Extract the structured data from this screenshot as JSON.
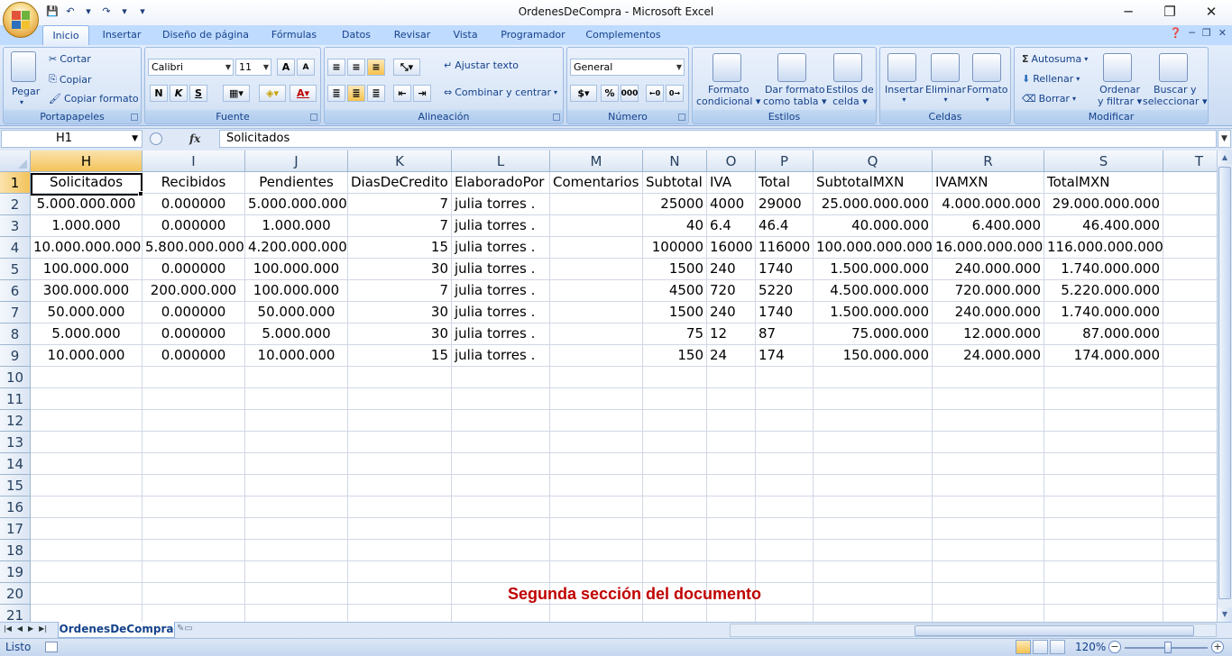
{
  "window": {
    "title": "OrdenesDeCompra - Microsoft Excel",
    "minimize": "─",
    "restore": "❐",
    "close": "✕"
  },
  "qat": {
    "save": "💾",
    "undo": "↶",
    "redo": "↷",
    "customize": "▾"
  },
  "tabs": [
    {
      "label": "Inicio",
      "active": true
    },
    {
      "label": "Insertar"
    },
    {
      "label": "Diseño de página"
    },
    {
      "label": "Fórmulas"
    },
    {
      "label": "Datos"
    },
    {
      "label": "Revisar"
    },
    {
      "label": "Vista"
    },
    {
      "label": "Programador"
    },
    {
      "label": "Complementos"
    }
  ],
  "ribbon": {
    "portapapeles": {
      "label": "Portapapeles",
      "pegar": "Pegar",
      "cortar": "Cortar",
      "copiar": "Copiar",
      "copiar_formato": "Copiar formato"
    },
    "fuente": {
      "label": "Fuente",
      "font": "Calibri",
      "size": "11",
      "bold": "N",
      "italic": "K",
      "underline": "S",
      "grow": "A",
      "shrink": "A"
    },
    "alineacion": {
      "label": "Alineación",
      "ajustar": "Ajustar texto",
      "combinar": "Combinar y centrar"
    },
    "numero": {
      "label": "Número",
      "format": "General",
      "percent": "%",
      "thousands": "000"
    },
    "estilos": {
      "label": "Estilos",
      "formato_cond_1": "Formato",
      "formato_cond_2": "condicional",
      "dar_formato_1": "Dar formato",
      "dar_formato_2": "como tabla",
      "estilos_celda_1": "Estilos de",
      "estilos_celda_2": "celda"
    },
    "celdas": {
      "label": "Celdas",
      "insertar": "Insertar",
      "eliminar": "Eliminar",
      "formato": "Formato"
    },
    "modificar": {
      "label": "Modificar",
      "autosuma": "Autosuma",
      "rellenar": "Rellenar",
      "borrar": "Borrar",
      "ordenar_1": "Ordenar",
      "ordenar_2": "y filtrar",
      "buscar_1": "Buscar y",
      "buscar_2": "seleccionar"
    }
  },
  "formula_bar": {
    "name_box": "H1",
    "fx": "fx",
    "value": "Solicitados"
  },
  "grid": {
    "columns": [
      "H",
      "I",
      "J",
      "K",
      "L",
      "M",
      "N",
      "O",
      "P",
      "Q",
      "R",
      "S",
      "T"
    ],
    "row_numbers": [
      "1",
      "2",
      "3",
      "4",
      "5",
      "6",
      "7",
      "8",
      "9",
      "10",
      "11",
      "12",
      "13",
      "14",
      "15",
      "16",
      "17",
      "18",
      "19",
      "20",
      "21"
    ],
    "rows": [
      [
        "Solicitados",
        "Recibidos",
        "Pendientes",
        "DiasDeCredito",
        "ElaboradoPor",
        "Comentarios",
        "Subtotal",
        "IVA",
        "Total",
        "SubtotalMXN",
        "IVAMXN",
        "TotalMXN"
      ],
      [
        "5.000.000.000",
        "0.000000",
        "5.000.000.000",
        "7",
        "julia torres .",
        "",
        "25000",
        "4000",
        "29000",
        "25.000.000.000",
        "4.000.000.000",
        "29.000.000.000"
      ],
      [
        "1.000.000",
        "0.000000",
        "1.000.000",
        "7",
        "julia torres .",
        "",
        "40",
        "6.4",
        "46.4",
        "40.000.000",
        "6.400.000",
        "46.400.000"
      ],
      [
        "10.000.000.000",
        "5.800.000.000",
        "4.200.000.000",
        "15",
        "julia torres .",
        "",
        "100000",
        "16000",
        "116000",
        "100.000.000.000",
        "16.000.000.000",
        "116.000.000.000"
      ],
      [
        "100.000.000",
        "0.000000",
        "100.000.000",
        "30",
        "julia torres .",
        "",
        "1500",
        "240",
        "1740",
        "1.500.000.000",
        "240.000.000",
        "1.740.000.000"
      ],
      [
        "300.000.000",
        "200.000.000",
        "100.000.000",
        "7",
        "julia torres .",
        "",
        "4500",
        "720",
        "5220",
        "4.500.000.000",
        "720.000.000",
        "5.220.000.000"
      ],
      [
        "50.000.000",
        "0.000000",
        "50.000.000",
        "30",
        "julia torres .",
        "",
        "1500",
        "240",
        "1740",
        "1.500.000.000",
        "240.000.000",
        "1.740.000.000"
      ],
      [
        "5.000.000",
        "0.000000",
        "5.000.000",
        "30",
        "julia torres .",
        "",
        "75",
        "12",
        "87",
        "75.000.000",
        "12.000.000",
        "87.000.000"
      ],
      [
        "10.000.000",
        "0.000000",
        "10.000.000",
        "15",
        "julia torres .",
        "",
        "150",
        "24",
        "174",
        "150.000.000",
        "24.000.000",
        "174.000.000"
      ]
    ],
    "active_cell": "H1"
  },
  "caption": "Segunda sección del documento",
  "sheet_tabs": [
    {
      "label": "OrdenesDeCompra",
      "active": true
    }
  ],
  "status": {
    "text": "Listo",
    "zoom": "120%"
  },
  "colors": {
    "accent": "#15428b",
    "ribbon_bg": "#dfe8f6",
    "selection": "#f3c35a",
    "caption": "#c00000"
  }
}
